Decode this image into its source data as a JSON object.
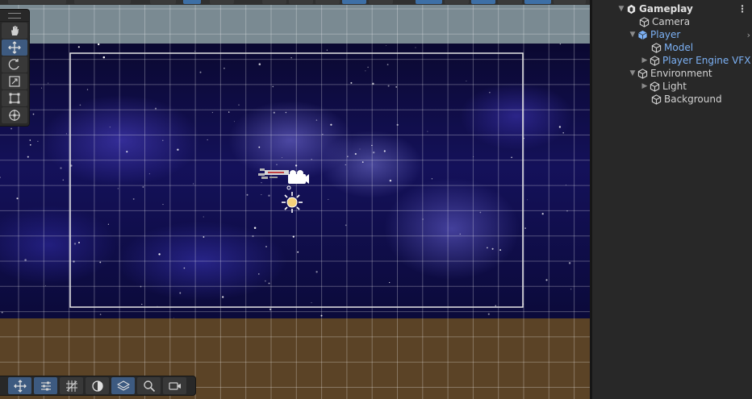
{
  "hierarchy": {
    "scene_name": "Gameplay",
    "items": [
      {
        "label": "Camera",
        "prefab": false,
        "arrow": ""
      },
      {
        "label": "Player",
        "prefab": true,
        "arrow": "▼"
      },
      {
        "label": "Model",
        "prefab": true,
        "arrow": ""
      },
      {
        "label": "Player Engine VFX",
        "prefab": true,
        "arrow": "▶"
      },
      {
        "label": "Environment",
        "prefab": false,
        "arrow": "▼"
      },
      {
        "label": "Light",
        "prefab": false,
        "arrow": "▶"
      },
      {
        "label": "Background",
        "prefab": false,
        "arrow": ""
      }
    ],
    "menu_icon": "kebab-menu-icon",
    "expand_icon": "chevron-right-icon"
  },
  "scene_tools": [
    "hand-tool-icon",
    "move-tool-icon",
    "rotate-tool-icon",
    "scale-tool-icon",
    "rect-tool-icon",
    "transform-tool-icon"
  ],
  "active_tool": "move-tool-icon",
  "bottom_overlay": [
    "move-icon",
    "snap-settings-icon",
    "grid-icon",
    "shading-icon",
    "layers-icon",
    "search-icon",
    "camera-icon"
  ],
  "colors": {
    "prefab_blue": "#7cb1f5",
    "active_tool": "#3d5a80",
    "panel_bg": "#282828",
    "ground": "#5b4326",
    "sky_band": "#7a8a92"
  }
}
